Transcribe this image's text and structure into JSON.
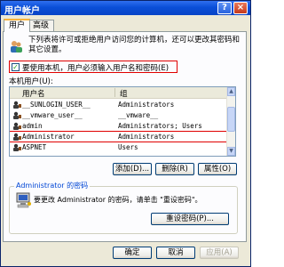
{
  "window": {
    "title": "用户帐户"
  },
  "titlebar_buttons": {
    "help": "?",
    "close": "×"
  },
  "tabs": [
    {
      "label": "用户"
    },
    {
      "label": "高级"
    }
  ],
  "intro": {
    "text": "下列表将许可或拒绝用户访问您的计算机，还可以更改其密码和其它设置。"
  },
  "checkbox": {
    "checked": true,
    "mark": "✓",
    "label": "要使用本机，用户必须输入用户名和密码(E)"
  },
  "users_label": "本机用户(U):",
  "list": {
    "columns": [
      "用户名",
      "组"
    ],
    "rows": [
      {
        "name": "__SUNLOGIN_USER__",
        "group": "Administrators"
      },
      {
        "name": "__vmware_user__",
        "group": "__vmware__"
      },
      {
        "name": "admin",
        "group": "Administrators; Users"
      },
      {
        "name": "Administrator",
        "group": "Administrators"
      },
      {
        "name": "ASPNET",
        "group": "Users"
      }
    ]
  },
  "list_buttons": {
    "add": "添加(D)...",
    "remove": "删除(R)",
    "properties": "属性(O)"
  },
  "password_group": {
    "title": "Administrator 的密码",
    "text": "要更改 Administrator 的密码，请单击 \"重设密码\"。",
    "reset_button": "重设密码(P)..."
  },
  "footer": {
    "ok": "确定",
    "cancel": "取消",
    "apply": "应用(A)"
  },
  "colors": {
    "titlebar": "#0a4fd8",
    "highlight_box": "#e00000",
    "group_title": "#0046d5"
  }
}
